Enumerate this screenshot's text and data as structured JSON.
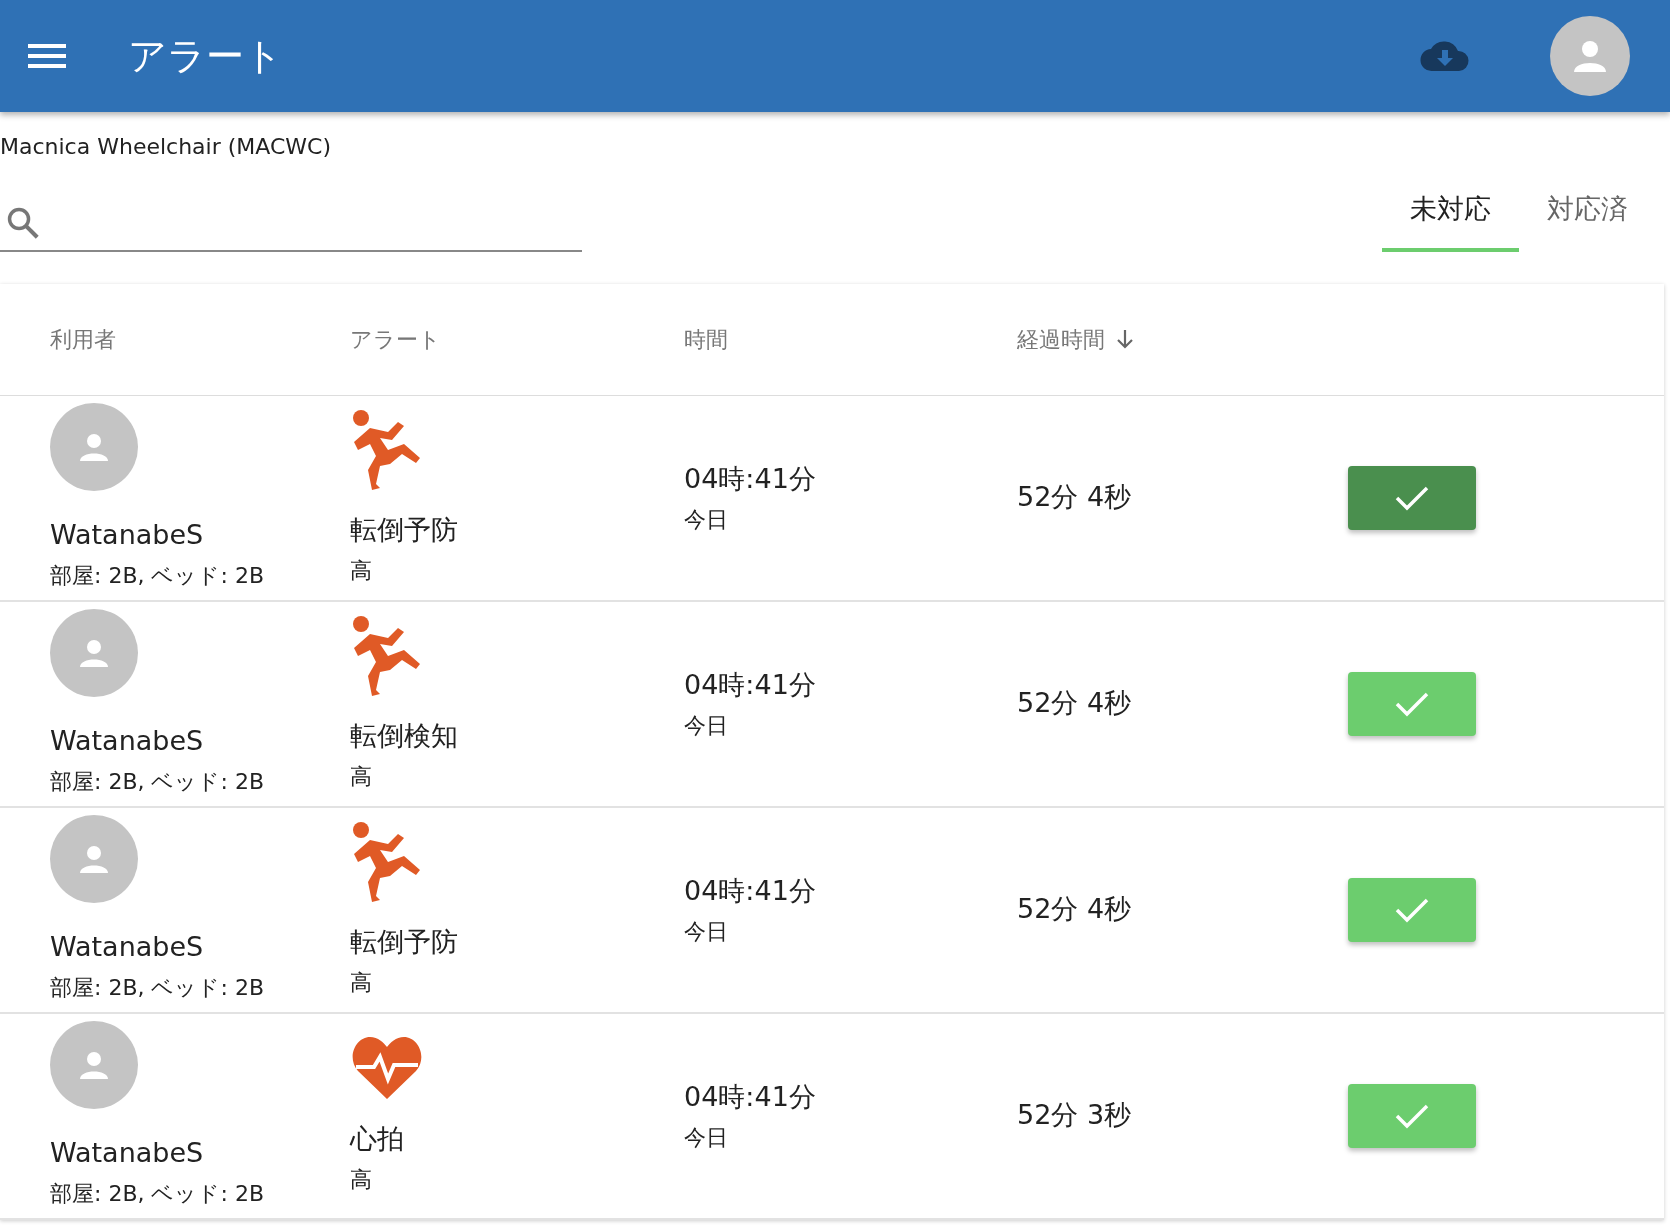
{
  "app_bar": {
    "title": "アラート"
  },
  "facility": "Macnica Wheelchair (MACWC)",
  "tabs": [
    {
      "label": "未対応",
      "selected": true
    },
    {
      "label": "対応済",
      "selected": false
    }
  ],
  "table": {
    "columns": [
      {
        "label": "利用者",
        "sorted": false
      },
      {
        "label": "アラート",
        "sorted": false
      },
      {
        "label": "時間",
        "sorted": false
      },
      {
        "label": "経過時間",
        "sorted": true
      }
    ],
    "rows": [
      {
        "user": "WatanabeS",
        "room": "部屋: 2B, ベッド: 2B",
        "kind": "fall",
        "alert": "転倒予防",
        "priority": "高",
        "time": "04時:41分",
        "day": "今日",
        "elapsed": "52分 4秒",
        "highlighted": true
      },
      {
        "user": "WatanabeS",
        "room": "部屋: 2B, ベッド: 2B",
        "kind": "fall",
        "alert": "転倒検知",
        "priority": "高",
        "time": "04時:41分",
        "day": "今日",
        "elapsed": "52分 4秒",
        "highlighted": false
      },
      {
        "user": "WatanabeS",
        "room": "部屋: 2B, ベッド: 2B",
        "kind": "fall",
        "alert": "転倒予防",
        "priority": "高",
        "time": "04時:41分",
        "day": "今日",
        "elapsed": "52分 4秒",
        "highlighted": false
      },
      {
        "user": "WatanabeS",
        "room": "部屋: 2B, ベッド: 2B",
        "kind": "heart",
        "alert": "心拍",
        "priority": "高",
        "time": "04時:41分",
        "day": "今日",
        "elapsed": "52分 3秒",
        "highlighted": false
      }
    ]
  }
}
